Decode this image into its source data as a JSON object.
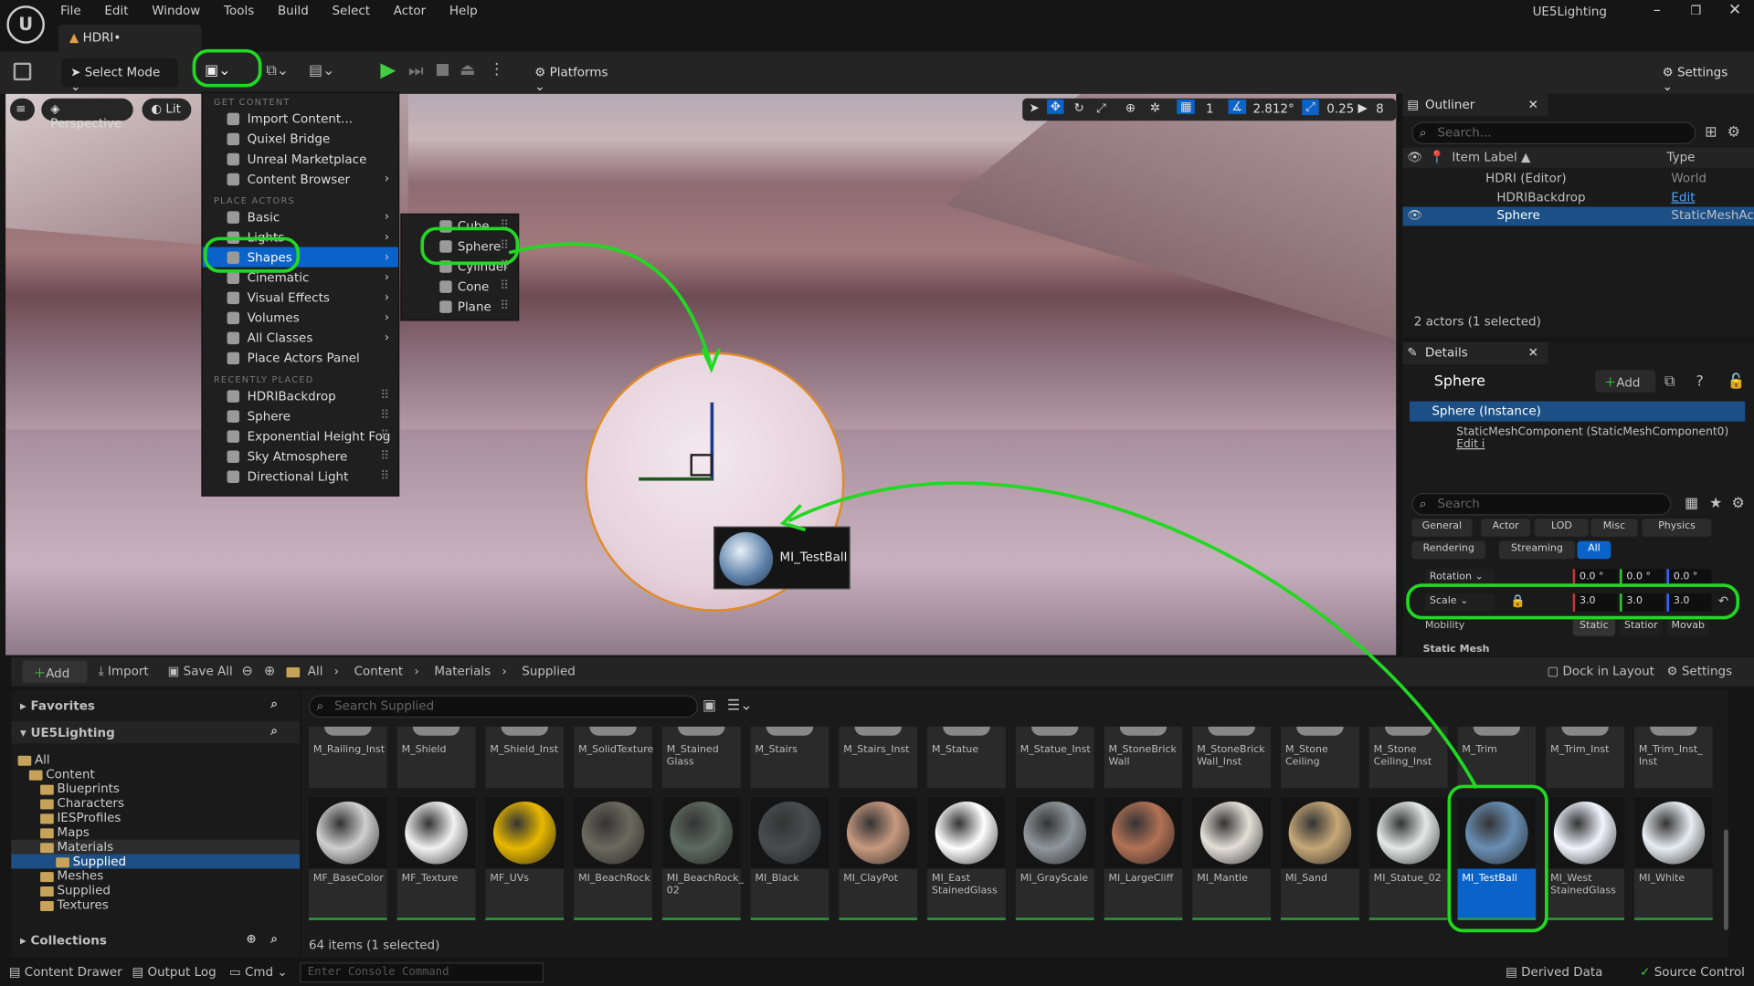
{
  "window": {
    "title": "UE5Lighting",
    "tab": "HDRI•"
  },
  "menubar": [
    "File",
    "Edit",
    "Window",
    "Tools",
    "Build",
    "Select",
    "Actor",
    "Help"
  ],
  "toolbar": {
    "select_mode": "Select Mode",
    "platforms": "Platforms",
    "settings": "Settings"
  },
  "viewport": {
    "perspective": "Perspective",
    "lit": "Lit",
    "angle": "2.812°",
    "scale": "0.25",
    "grid": "1",
    "camera_speed": "8",
    "drag_label": "MI_TestBall"
  },
  "add_menu": {
    "section_get": "GET CONTENT",
    "get_items": [
      "Import Content...",
      "Quixel Bridge",
      "Unreal Marketplace",
      "Content Browser"
    ],
    "section_place": "PLACE ACTORS",
    "place_items": [
      "Basic",
      "Lights",
      "Shapes",
      "Cinematic",
      "Visual Effects",
      "Volumes",
      "All Classes",
      "Place Actors Panel"
    ],
    "section_recent": "RECENTLY PLACED",
    "recent_items": [
      "HDRIBackdrop",
      "Sphere",
      "Exponential Height Fog",
      "Sky Atmosphere",
      "Directional Light"
    ]
  },
  "shapes_menu": [
    "Cube",
    "Sphere",
    "Cylinder",
    "Cone",
    "Plane"
  ],
  "outliner": {
    "title": "Outliner",
    "search": "Search...",
    "col_label": "Item Label ▲",
    "col_type": "Type",
    "rows": [
      {
        "label": "HDRI (Editor)",
        "type": "World"
      },
      {
        "label": "HDRIBackdrop",
        "type": "Edit HDRIBacka"
      },
      {
        "label": "Sphere",
        "type": "StaticMeshActo"
      }
    ],
    "summary": "2 actors (1 selected)"
  },
  "details": {
    "title": "Details",
    "object": "Sphere",
    "add": "Add",
    "instance": "Sphere (Instance)",
    "component": "StaticMeshComponent (StaticMeshComponent0)",
    "component_edit": "Edit i",
    "search": "Search",
    "filters": [
      "General",
      "Actor",
      "LOD",
      "Misc",
      "Physics",
      "Rendering",
      "Streaming",
      "All"
    ],
    "rotation": {
      "label": "Rotation",
      "x": "0.0 °",
      "y": "0.0 °",
      "z": "0.0 °"
    },
    "scale": {
      "label": "Scale",
      "x": "3.0",
      "y": "3.0",
      "z": "3.0"
    },
    "mobility": {
      "label": "Mobility",
      "options": [
        "Static",
        "Statior",
        "Movab"
      ]
    },
    "section": "Static Mesh"
  },
  "content_bar": {
    "add": "Add",
    "import": "Import",
    "save_all": "Save All",
    "breadcrumb": [
      "All",
      "Content",
      "Materials",
      "Supplied"
    ],
    "dock": "Dock in Layout",
    "settings": "Settings"
  },
  "sources": {
    "favorites": "Favorites",
    "project": "UE5Lighting",
    "tree": [
      "All",
      "Content",
      "Blueprints",
      "Characters",
      "IESProfiles",
      "Maps",
      "Materials",
      "Supplied",
      "Meshes",
      "Supplied",
      "Textures"
    ],
    "collections": "Collections"
  },
  "assets": {
    "search": "Search Supplied",
    "top_row": [
      "M_Railing_Inst",
      "M_Shield",
      "M_Shield_Inst",
      "M_SolidTexture",
      "M_Stained Glass",
      "M_Stairs",
      "M_Stairs_Inst",
      "M_Statue",
      "M_Statue_Inst",
      "M_StoneBrick Wall",
      "M_StoneBrick Wall_Inst",
      "M_Stone Ceiling",
      "M_Stone Ceiling_Inst",
      "M_Trim",
      "M_Trim_Inst",
      "M_Trim_Inst_ Inst"
    ],
    "items": [
      {
        "name": "MF_BaseColor",
        "color": "#cfcfcf"
      },
      {
        "name": "MF_Texture",
        "color": "#f2f2f2"
      },
      {
        "name": "MF_UVs",
        "color": "#e8b800"
      },
      {
        "name": "MI_BeachRock",
        "color": "#6c6a5e"
      },
      {
        "name": "MI_BeachRock_ 02",
        "color": "#5e6a64"
      },
      {
        "name": "MI_Black",
        "color": "#4a4c4e"
      },
      {
        "name": "MI_ClayPot",
        "color": "#c79a80"
      },
      {
        "name": "MI_East StainedGlass",
        "color": "#ffffff"
      },
      {
        "name": "MI_GrayScale",
        "color": "#8f979c"
      },
      {
        "name": "MI_LargeCliff",
        "color": "#b27256"
      },
      {
        "name": "MI_Mantle",
        "color": "#e4e0d8"
      },
      {
        "name": "MI_Sand",
        "color": "#c6a878"
      },
      {
        "name": "MI_Statue_02",
        "color": "#e6e8e8"
      },
      {
        "name": "MI_TestBall",
        "color": "#6a8fb4"
      },
      {
        "name": "MI_West StainedGlass",
        "color": "#f2f4ff"
      },
      {
        "name": "MI_White",
        "color": "#e8eef2"
      }
    ],
    "count": "64 items (1 selected)"
  },
  "statusbar": {
    "drawer": "Content Drawer",
    "output": "Output Log",
    "cmd": "Cmd",
    "console": "Enter Console Command",
    "derived": "Derived Data",
    "source": "Source Control"
  }
}
